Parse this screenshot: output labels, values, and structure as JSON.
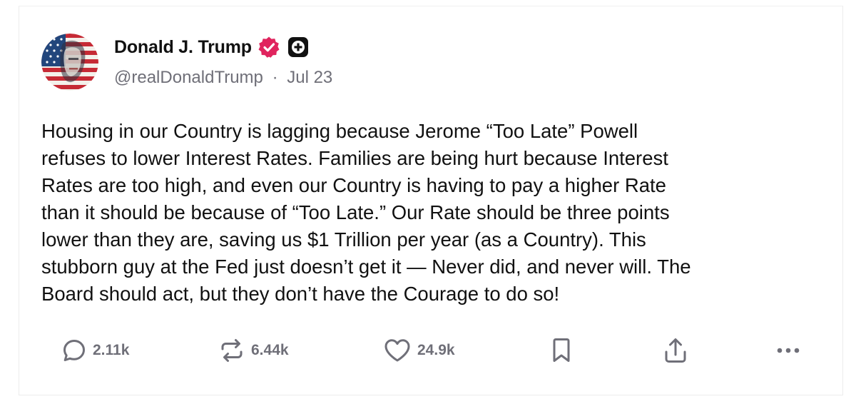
{
  "post": {
    "author": {
      "display_name": "Donald J. Trump",
      "handle": "@realDonaldTrump",
      "separator": "·",
      "date": "Jul 23",
      "avatar_icon": "flag-portrait-avatar",
      "verified_icon": "verified-badge-icon",
      "verified_color": "#e0245e",
      "plus_icon": "plus-badge-icon"
    },
    "text": "Housing in our Country is lagging because Jerome “Too Late” Powell\nrefuses to lower Interest Rates. Families are being hurt because Interest\nRates are too high, and even our Country is having to pay a higher Rate\nthan it should be because of “Too Late.” Our Rate should be three points\nlower than they are, saving us $1 Trillion per year (as a Country). This\nstubborn guy at the Fed just doesn’t get it — Never did, and never will. The\nBoard should act, but they don’t have the Courage to do so!",
    "actions": {
      "replies": {
        "icon": "reply-icon",
        "count": "2.11k"
      },
      "reposts": {
        "icon": "repost-icon",
        "count": "6.44k"
      },
      "likes": {
        "icon": "heart-icon",
        "count": "24.9k"
      },
      "bookmark": {
        "icon": "bookmark-icon"
      },
      "share": {
        "icon": "share-icon"
      },
      "more": {
        "icon": "more-icon"
      }
    },
    "colors": {
      "text_primary": "#111111",
      "text_secondary": "#6f6f78",
      "border": "#ececec"
    }
  }
}
